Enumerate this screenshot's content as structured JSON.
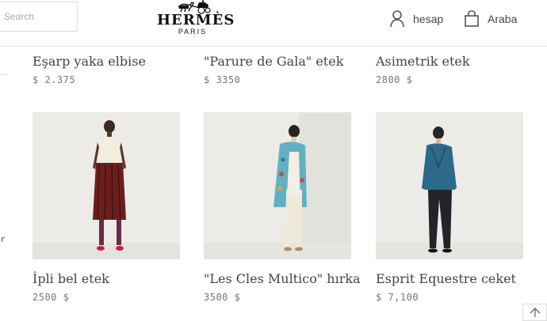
{
  "header": {
    "search_placeholder": "Search",
    "brand": "HERMÈS",
    "brand_city": "PARIS",
    "account_label": "hesap",
    "cart_label": "Araba"
  },
  "left_edge": {
    "char": "r"
  },
  "products_top": [
    {
      "title": "Eşarp yaka elbise",
      "price": "$ 2.375"
    },
    {
      "title": "\"Parure de Gala\" etek",
      "price": "$ 3350"
    },
    {
      "title": "Asimetrik etek",
      "price": "2800 $"
    }
  ],
  "products_bottom": [
    {
      "title": "İpli bel etek",
      "price": "2500 $"
    },
    {
      "title": "\"Les Cles Multico\" hırka",
      "price": "3500 $"
    },
    {
      "title": "Esprit Equestre ceket",
      "price": "$ 7,100"
    }
  ],
  "icons": [
    "user-icon",
    "shopping-bag-icon",
    "arrow-up-icon",
    "horse-carriage-icon"
  ],
  "colors": {
    "text": "#444444",
    "price": "#777777",
    "photo_bg": "#ecebe7"
  }
}
